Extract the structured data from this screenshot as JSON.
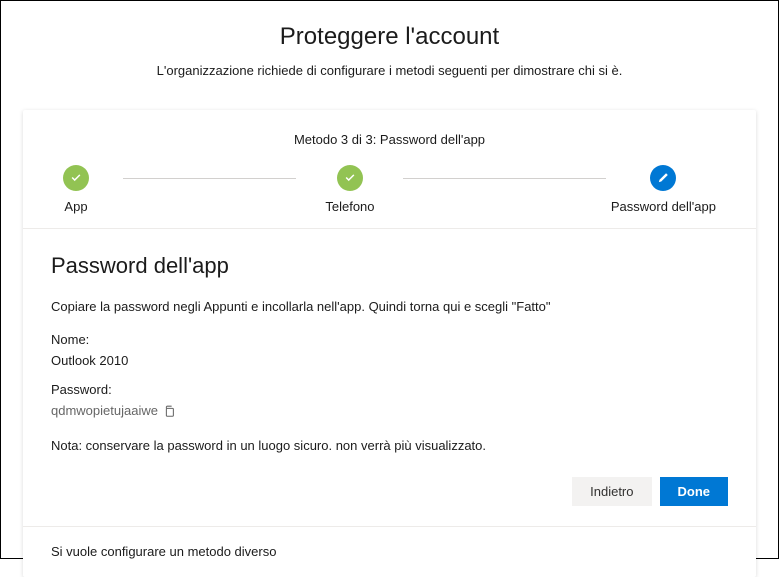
{
  "header": {
    "title": "Proteggere l'account",
    "subtitle": "L'organizzazione richiede di configurare i metodi seguenti per dimostrare chi si è."
  },
  "stepper": {
    "title": "Metodo 3 di 3: Password dell'app",
    "steps": [
      {
        "label": "App",
        "state": "done"
      },
      {
        "label": "Telefono",
        "state": "done"
      },
      {
        "label": "Password dell'app",
        "state": "current"
      }
    ]
  },
  "content": {
    "heading": "Password dell'app",
    "instruction": "Copiare la password negli Appunti e incollarla nell'app. Quindi torna qui e scegli \"Fatto\"",
    "name_label": "Nome:",
    "name_value": "Outlook 2010",
    "password_label": "Password:",
    "password_value": "qdmwopietujaaiwe",
    "note": "Nota: conservare la password in un luogo sicuro. non verrà più visualizzato."
  },
  "buttons": {
    "back": "Indietro",
    "done": "Done"
  },
  "footer": {
    "different_method": "Si vuole configurare un metodo diverso"
  }
}
